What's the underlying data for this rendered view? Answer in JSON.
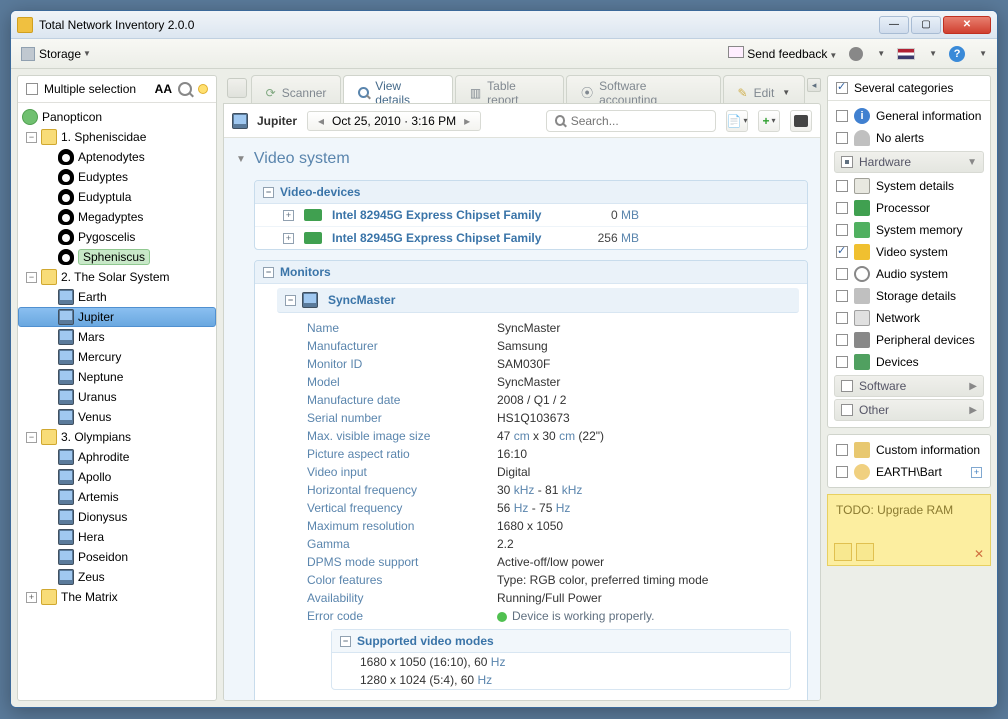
{
  "title": "Total Network Inventory 2.0.0",
  "toolbar": {
    "storage": "Storage",
    "feedback": "Send feedback"
  },
  "left": {
    "header": "Multiple selection",
    "root": "Panopticon",
    "g1": {
      "label": "1. Spheniscidae",
      "items": [
        "Aptenodytes",
        "Eudyptes",
        "Eudyptula",
        "Megadyptes",
        "Pygoscelis",
        "Spheniscus"
      ]
    },
    "g2": {
      "label": "2. The Solar System",
      "items": [
        "Earth",
        "Jupiter",
        "Mars",
        "Mercury",
        "Neptune",
        "Uranus",
        "Venus"
      ]
    },
    "g3": {
      "label": "3. Olympians",
      "items": [
        "Aphrodite",
        "Apollo",
        "Artemis",
        "Dionysus",
        "Hera",
        "Poseidon",
        "Zeus"
      ]
    },
    "g4": {
      "label": "The Matrix"
    }
  },
  "tabs": {
    "scanner": "Scanner",
    "view": "View details",
    "table": "Table report",
    "soft": "Software accounting",
    "edit": "Edit"
  },
  "centerbar": {
    "host": "Jupiter",
    "date": "Oct 25, 2010 · 3:16 PM",
    "search_ph": "Search..."
  },
  "section": {
    "title": "Video system",
    "devhdr": "Video-devices",
    "dev1": {
      "name": "Intel 82945G Express Chipset Family",
      "val": "0",
      "unit": "MB"
    },
    "dev2": {
      "name": "Intel 82945G Express Chipset Family",
      "val": "256",
      "unit": "MB"
    },
    "monhdr": "Monitors",
    "monname": "SyncMaster",
    "props": {
      "Name": "SyncMaster",
      "Manufacturer": "Samsung",
      "Monitor ID": "SAM030F",
      "Model": "SyncMaster",
      "Manufacture date": "2008 / Q1 / 2",
      "Serial number": "HS1Q103673",
      "Picture aspect ratio": "16:10",
      "Video input": "Digital",
      "Maximum resolution": "1680 x 1050",
      "Gamma": "2.2",
      "DPMS mode support": "Active-off/low power",
      "Color features": "Type: RGB color, preferred timing mode",
      "Availability": "Running/Full Power"
    },
    "size": {
      "label": "Max. visible image size",
      "w": "47",
      "h": "30",
      "unit": "cm",
      "diag": "(22\")"
    },
    "hf": {
      "label": "Horizontal frequency",
      "lo": "30",
      "hi": "81",
      "unit": "kHz"
    },
    "vf": {
      "label": "Vertical frequency",
      "lo": "56",
      "hi": "75",
      "unit": "Hz"
    },
    "err": {
      "label": "Error code",
      "val": "Device is working properly."
    },
    "modeshdr": "Supported video modes",
    "mode1": {
      "res": "1680 x 1050 (16:10), 60",
      "unit": "Hz"
    },
    "mode2": {
      "res": "1280 x 1024 (5:4), 60",
      "unit": "Hz"
    }
  },
  "right": {
    "cat": "Several categories",
    "gi": "General information",
    "na": "No alerts",
    "hw": "Hardware",
    "hw_items": {
      "sd": "System details",
      "cpu": "Processor",
      "mem": "System memory",
      "vid": "Video system",
      "aud": "Audio system",
      "stor": "Storage details",
      "net": "Network",
      "peri": "Peripheral devices",
      "dev": "Devices"
    },
    "sw": "Software",
    "other": "Other",
    "cust": "Custom information",
    "user": "EARTH\\Bart",
    "note": "TODO: Upgrade RAM"
  }
}
